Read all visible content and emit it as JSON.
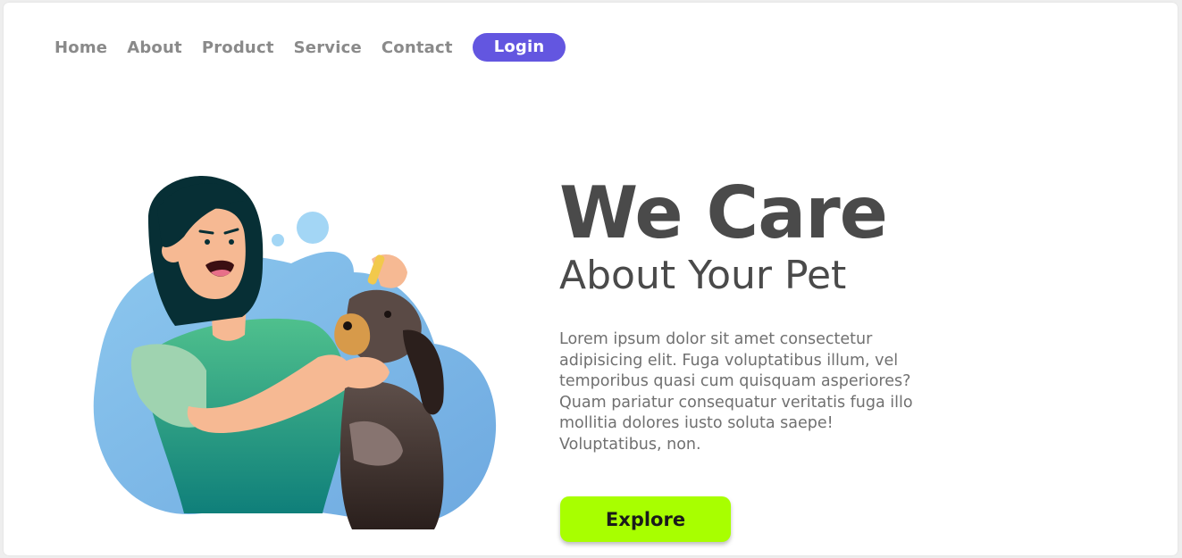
{
  "nav": {
    "items": [
      {
        "label": "Home"
      },
      {
        "label": "About"
      },
      {
        "label": "Product"
      },
      {
        "label": "Service"
      },
      {
        "label": "Contact"
      }
    ],
    "login_label": "Login"
  },
  "hero": {
    "title": "We Care",
    "subtitle": "About Your Pet",
    "body": "Lorem ipsum dolor sit amet consectetur adipisicing elit. Fuga voluptatibus illum, vel temporibus quasi cum quisquam asperiores? Quam pariatur consequatur veritatis fuga illo mollitia dolores iusto soluta saepe! Voluptatibus, non.",
    "cta_label": "Explore"
  },
  "colors": {
    "accent": "#6356e0",
    "cta": "#a8ff00",
    "heading": "#4a4a4a"
  }
}
